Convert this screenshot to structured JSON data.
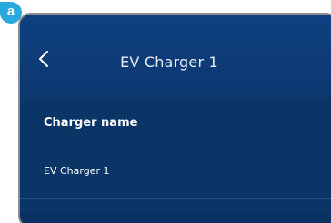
{
  "badge": {
    "label": "a"
  },
  "header": {
    "title": "EV Charger 1",
    "back_icon": "chevron-left-icon"
  },
  "charger": {
    "label": "Charger name",
    "value": "EV Charger 1"
  },
  "colors": {
    "background": "#0c3567",
    "badge": "#29a8e0",
    "text": "#ffffff"
  }
}
